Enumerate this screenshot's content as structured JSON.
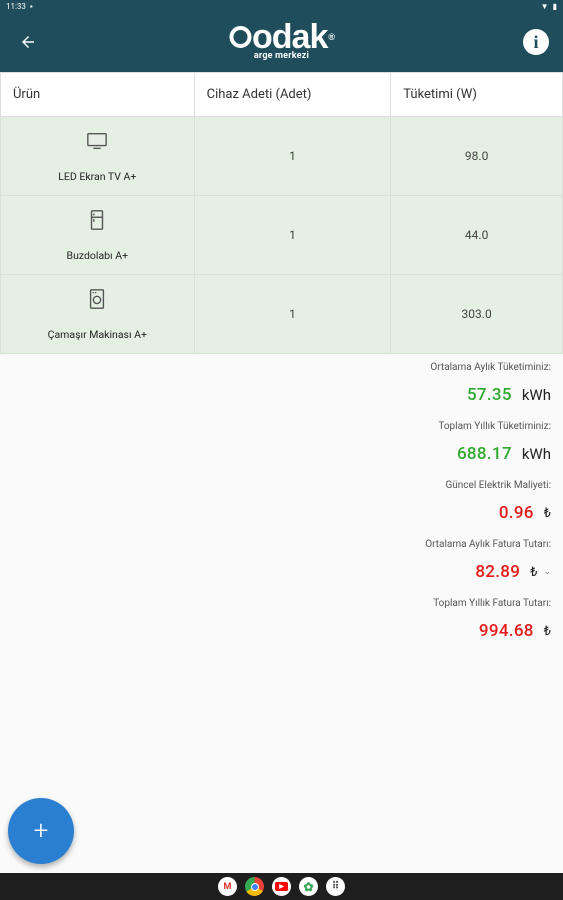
{
  "status_bar": {
    "time": "11:33"
  },
  "app_bar": {
    "logo_text": "odak",
    "logo_sub": "arge merkezi",
    "logo_reg": "®"
  },
  "table": {
    "headers": [
      "Ürün",
      "Cihaz Adeti (Adet)",
      "Tüketimi (W)"
    ],
    "rows": [
      {
        "icon": "tv-icon",
        "name": "LED Ekran TV A+",
        "count": "1",
        "consumption": "98.0"
      },
      {
        "icon": "refrigerator-icon",
        "name": "Buzdolabı A+",
        "count": "1",
        "consumption": "44.0"
      },
      {
        "icon": "washing-machine-icon",
        "name": "Çamaşır Makinası A+",
        "count": "1",
        "consumption": "303.0"
      }
    ]
  },
  "summary": {
    "monthly_label": "Ortalama Aylık Tüketiminiz:",
    "monthly_value": "57.35",
    "monthly_unit": "kWh",
    "yearly_label": "Toplam Yıllık Tüketiminiz:",
    "yearly_value": "688.17",
    "yearly_unit": "kWh",
    "price_label": "Güncel Elektrik Maliyeti:",
    "price_value": "0.96",
    "price_unit": "₺",
    "monthly_bill_label": "Ortalama Aylık Fatura Tutarı:",
    "monthly_bill_value": "82.89",
    "monthly_bill_unit": "₺",
    "yearly_bill_label": "Toplam Yıllık Fatura Tutarı:",
    "yearly_bill_value": "994.68",
    "yearly_bill_unit": "₺"
  },
  "fab": {
    "label": "+"
  },
  "colors": {
    "primary": "#1f4d5c",
    "accent": "#2a7fd1",
    "green": "#2eaa2e",
    "red": "#e21b1b",
    "row_bg": "#e4f0e2"
  },
  "dock": [
    "gmail-icon",
    "chrome-icon",
    "youtube-icon",
    "photos-icon",
    "apps-icon"
  ]
}
